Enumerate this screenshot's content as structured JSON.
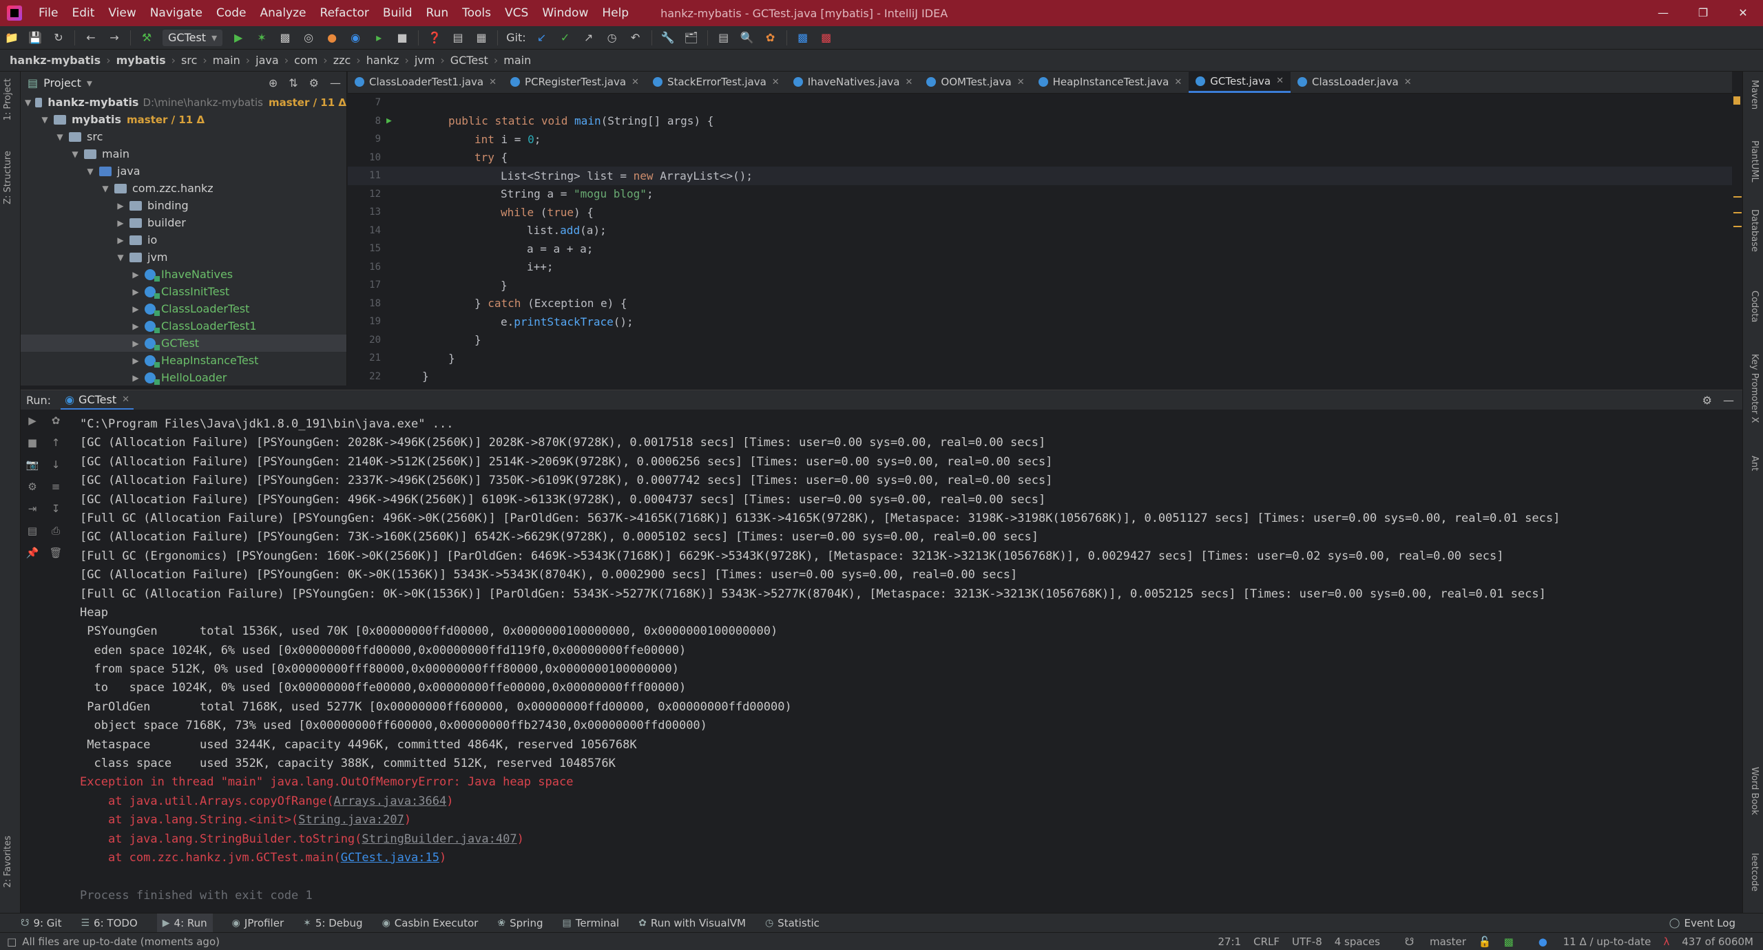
{
  "menu": [
    "File",
    "Edit",
    "View",
    "Navigate",
    "Code",
    "Analyze",
    "Refactor",
    "Build",
    "Run",
    "Tools",
    "VCS",
    "Window",
    "Help"
  ],
  "window_title": "hankz-mybatis - GCTest.java [mybatis] - IntelliJ IDEA",
  "toolbar": {
    "run_config": "GCTest",
    "git_label": "Git:"
  },
  "breadcrumb": [
    "hankz-mybatis",
    "mybatis",
    "src",
    "main",
    "java",
    "com",
    "zzc",
    "hankz",
    "jvm",
    "GCTest",
    "main"
  ],
  "left_strip": {
    "project": "1: Project",
    "structure": "Z: Structure",
    "favorites": "2: Favorites"
  },
  "project_panel": {
    "title": "Project",
    "tree": [
      {
        "label": "hankz-mybatis",
        "path": "D:\\mine\\hankz-mybatis",
        "branch": "master / 11 Δ",
        "level": 0
      },
      {
        "label": "mybatis",
        "branch": "master / 11 Δ",
        "level": 1
      },
      {
        "label": "src",
        "level": 2
      },
      {
        "label": "main",
        "level": 3
      },
      {
        "label": "java",
        "level": 4
      },
      {
        "label": "com.zzc.hankz",
        "level": 5
      },
      {
        "label": "binding",
        "level": 6
      },
      {
        "label": "builder",
        "level": 6
      },
      {
        "label": "io",
        "level": 6
      },
      {
        "label": "jvm",
        "level": 6
      },
      {
        "label": "IhaveNatives",
        "level": 7
      },
      {
        "label": "ClassInitTest",
        "level": 7
      },
      {
        "label": "ClassLoaderTest",
        "level": 7
      },
      {
        "label": "ClassLoaderTest1",
        "level": 7
      },
      {
        "label": "GCTest",
        "level": 7
      },
      {
        "label": "HeapInstanceTest",
        "level": 7
      },
      {
        "label": "HelloLoader",
        "level": 7
      }
    ]
  },
  "tabs": [
    "ClassLoaderTest1.java",
    "PCRegisterTest.java",
    "StackErrorTest.java",
    "IhaveNatives.java",
    "OOMTest.java",
    "HeapInstanceTest.java",
    "GCTest.java",
    "ClassLoader.java"
  ],
  "code_lines": [
    {
      "n": "7",
      "t": ""
    },
    {
      "n": "8",
      "t": "public static void main(String[] args) {"
    },
    {
      "n": "9",
      "t": "int i = 0;"
    },
    {
      "n": "10",
      "t": "try {"
    },
    {
      "n": "11",
      "t": "List<String> list = new ArrayList<>();"
    },
    {
      "n": "12",
      "t": "String a = \"mogu blog\";"
    },
    {
      "n": "13",
      "t": "while (true) {"
    },
    {
      "n": "14",
      "t": "list.add(a);"
    },
    {
      "n": "15",
      "t": "a = a + a;"
    },
    {
      "n": "16",
      "t": "i++;"
    },
    {
      "n": "17",
      "t": "}"
    },
    {
      "n": "18",
      "t": "} catch (Exception e) {"
    },
    {
      "n": "19",
      "t": "e.printStackTrace();"
    },
    {
      "n": "20",
      "t": "}"
    },
    {
      "n": "21",
      "t": "}"
    },
    {
      "n": "22",
      "t": "}"
    }
  ],
  "right_strip": [
    "Maven",
    "PlantUML",
    "Database",
    "Codota",
    "Key Promoter X",
    "Ant",
    "Word Book",
    "leetcode"
  ],
  "run_panel": {
    "label": "Run:",
    "tab": "GCTest",
    "console": [
      "\"C:\\Program Files\\Java\\jdk1.8.0_191\\bin\\java.exe\" ...",
      "[GC (Allocation Failure) [PSYoungGen: 2028K->496K(2560K)] 2028K->870K(9728K), 0.0017518 secs] [Times: user=0.00 sys=0.00, real=0.00 secs]",
      "[GC (Allocation Failure) [PSYoungGen: 2140K->512K(2560K)] 2514K->2069K(9728K), 0.0006256 secs] [Times: user=0.00 sys=0.00, real=0.00 secs]",
      "[GC (Allocation Failure) [PSYoungGen: 2337K->496K(2560K)] 7350K->6109K(9728K), 0.0007742 secs] [Times: user=0.00 sys=0.00, real=0.00 secs]",
      "[GC (Allocation Failure) [PSYoungGen: 496K->496K(2560K)] 6109K->6133K(9728K), 0.0004737 secs] [Times: user=0.00 sys=0.00, real=0.00 secs]",
      "[Full GC (Allocation Failure) [PSYoungGen: 496K->0K(2560K)] [ParOldGen: 5637K->4165K(7168K)] 6133K->4165K(9728K), [Metaspace: 3198K->3198K(1056768K)], 0.0051127 secs] [Times: user=0.00 sys=0.00, real=0.01 secs]",
      "[GC (Allocation Failure) [PSYoungGen: 73K->160K(2560K)] 6542K->6629K(9728K), 0.0005102 secs] [Times: user=0.00 sys=0.00, real=0.00 secs]",
      "[Full GC (Ergonomics) [PSYoungGen: 160K->0K(2560K)] [ParOldGen: 6469K->5343K(7168K)] 6629K->5343K(9728K), [Metaspace: 3213K->3213K(1056768K)], 0.0029427 secs] [Times: user=0.02 sys=0.00, real=0.00 secs]",
      "[GC (Allocation Failure) [PSYoungGen: 0K->0K(1536K)] 5343K->5343K(8704K), 0.0002900 secs] [Times: user=0.00 sys=0.00, real=0.00 secs]",
      "[Full GC (Allocation Failure) [PSYoungGen: 0K->0K(1536K)] [ParOldGen: 5343K->5277K(7168K)] 5343K->5277K(8704K), [Metaspace: 3213K->3213K(1056768K)], 0.0052125 secs] [Times: user=0.00 sys=0.00, real=0.01 secs]",
      "Heap",
      " PSYoungGen      total 1536K, used 70K [0x00000000ffd00000, 0x0000000100000000, 0x0000000100000000)",
      "  eden space 1024K, 6% used [0x00000000ffd00000,0x00000000ffd119f0,0x00000000ffe00000)",
      "  from space 512K, 0% used [0x00000000fff80000,0x00000000fff80000,0x0000000100000000)",
      "  to   space 1024K, 0% used [0x00000000ffe00000,0x00000000ffe00000,0x00000000fff00000)",
      " ParOldGen       total 7168K, used 5277K [0x00000000ff600000, 0x00000000ffd00000, 0x00000000ffd00000)",
      "  object space 7168K, 73% used [0x00000000ff600000,0x00000000ffb27430,0x00000000ffd00000)",
      " Metaspace       used 3244K, capacity 4496K, committed 4864K, reserved 1056768K",
      "  class space    used 352K, capacity 388K, committed 512K, reserved 1048576K"
    ],
    "exception": "Exception in thread \"main\" java.lang.OutOfMemoryError: Java heap space",
    "stack": [
      {
        "prefix": "\tat java.util.Arrays.copyOfRange(",
        "link": "Arrays.java:3664",
        "suffix": ")"
      },
      {
        "prefix": "\tat java.lang.String.<init>(",
        "link": "String.java:207",
        "suffix": ")"
      },
      {
        "prefix": "\tat java.lang.StringBuilder.toString(",
        "link": "StringBuilder.java:407",
        "suffix": ")"
      },
      {
        "prefix": "\tat com.zzc.hankz.jvm.GCTest.main(",
        "link": "GCTest.java:15",
        "suffix": ")"
      }
    ],
    "exit": "Process finished with exit code 1"
  },
  "tool_tabs": [
    "9: Git",
    "6: TODO",
    "4: Run",
    "JProfiler",
    "5: Debug",
    "Casbin Executor",
    "Spring",
    "Terminal",
    "Run with VisualVM",
    "Statistic"
  ],
  "event_log": "Event Log",
  "status": {
    "message": "All files are up-to-date (moments ago)",
    "position": "27:1",
    "line_sep": "CRLF",
    "encoding": "UTF-8",
    "indent": "4 spaces",
    "branch": "master",
    "vcs": "11 Δ / up-to-date",
    "memory": "437 of 6060M"
  }
}
